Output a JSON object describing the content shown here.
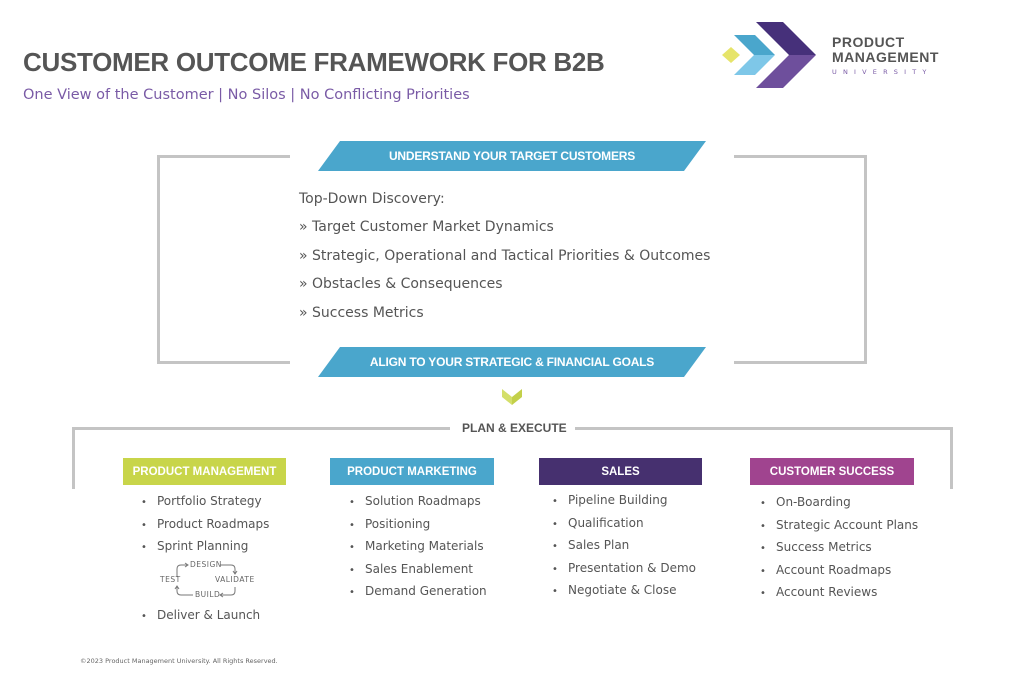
{
  "header": {
    "title": "CUSTOMER OUTCOME FRAMEWORK FOR B2B",
    "subtitle": "One View of the Customer | No Silos | No Conflicting Priorities"
  },
  "logo": {
    "line1": "PRODUCT",
    "line2": "MANAGEMENT",
    "line3": "UNIVERSITY",
    "colors": {
      "diamond": "#e6e46a",
      "light_blue_top": "#4aa6cc",
      "light_blue_bottom": "#7ec7e8",
      "purple_top": "#46307a",
      "purple_bottom": "#6e4f9c"
    }
  },
  "understand": {
    "banner": "UNDERSTAND YOUR TARGET CUSTOMERS",
    "heading": "Top-Down Discovery:",
    "items": [
      "» Target Customer Market Dynamics",
      "» Strategic, Operational and Tactical Priorities & Outcomes",
      "» Obstacles & Consequences",
      "» Success Metrics"
    ]
  },
  "align": {
    "banner": "ALIGN TO YOUR STRATEGIC & FINANCIAL GOALS"
  },
  "plan": {
    "label": "PLAN & EXECUTE",
    "columns": [
      {
        "title": "PRODUCT MANAGEMENT",
        "color": "#c8d54a",
        "items": [
          "Portfolio Strategy",
          "Product Roadmaps",
          "Sprint Planning",
          "Deliver & Launch"
        ],
        "cycle": {
          "top": "DESIGN",
          "right": "VALIDATE",
          "bottom": "BUILD",
          "left": "TEST"
        }
      },
      {
        "title": "PRODUCT MARKETING",
        "color": "#4aa6cc",
        "items": [
          "Solution Roadmaps",
          "Positioning",
          "Marketing Materials",
          "Sales Enablement",
          "Demand Generation"
        ]
      },
      {
        "title": "SALES",
        "color": "#46306f",
        "items": [
          "Pipeline Building",
          "Qualification",
          "Sales Plan",
          "Presentation & Demo",
          "Negotiate & Close"
        ]
      },
      {
        "title": "CUSTOMER SUCCESS",
        "color": "#a0448f",
        "items": [
          "On-Boarding",
          "Strategic Account Plans",
          "Success Metrics",
          "Account Roadmaps",
          "Account Reviews"
        ]
      }
    ]
  },
  "colors": {
    "banner_blue": "#4aa6cc",
    "chevron_green": "#c8d54a",
    "frame_gray": "#c4c4c4",
    "text_gray": "#555555",
    "subtitle_purple": "#7a5ba6"
  },
  "bullet": "•",
  "footer": "©2023 Product Management University. All Rights Reserved."
}
